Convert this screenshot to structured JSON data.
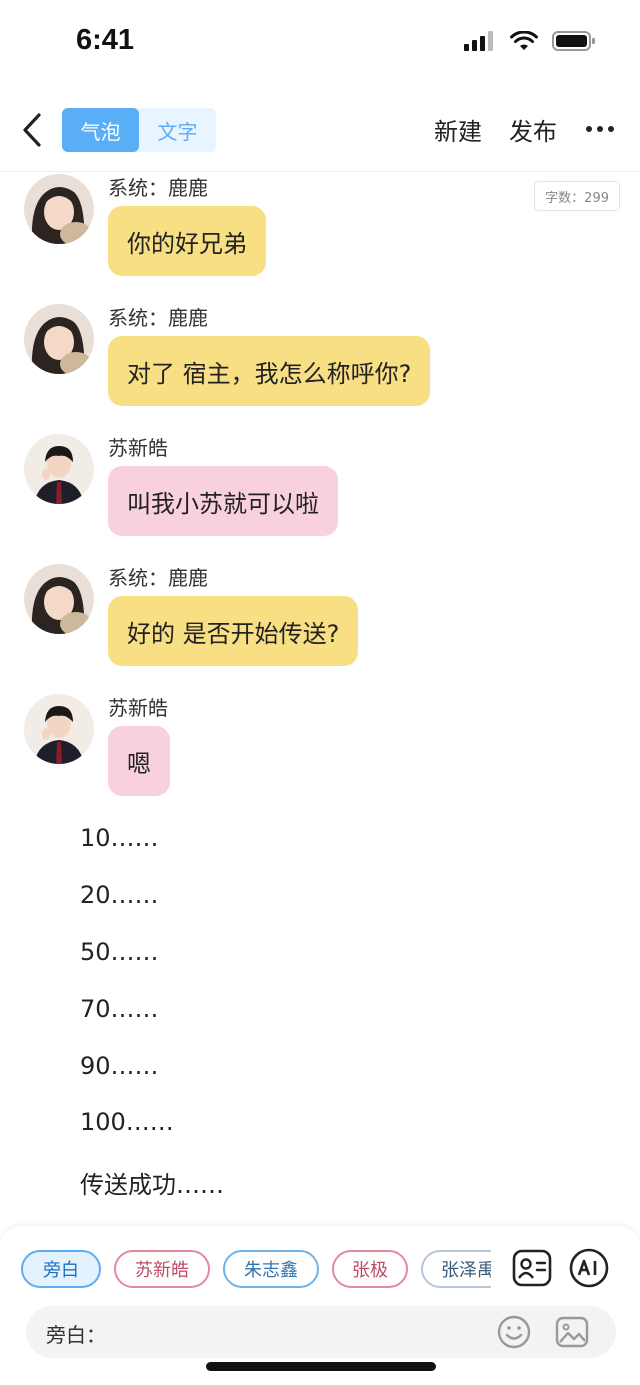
{
  "status_bar": {
    "time": "6:41"
  },
  "nav": {
    "mode_options": [
      "气泡",
      "文字"
    ],
    "active_mode": "气泡",
    "new_label": "新建",
    "publish_label": "发布"
  },
  "word_count": "字数：299",
  "messages": [
    {
      "sender": "系统：鹿鹿",
      "text": "你的好兄弟",
      "bubble_color": "#f8df84"
    },
    {
      "sender": "系统：鹿鹿",
      "text": "对了 宿主，我怎么称呼你?",
      "bubble_color": "#f8df84"
    },
    {
      "sender": "苏新皓",
      "text": "叫我小苏就可以啦",
      "bubble_color": "#f8d1dc"
    },
    {
      "sender": "系统：鹿鹿",
      "text": "好的 是否开始传送?",
      "bubble_color": "#f8df84"
    },
    {
      "sender": "苏新皓",
      "text": "嗯",
      "bubble_color": "#f8d1dc"
    }
  ],
  "narration": [
    "10……",
    "20……",
    "50……",
    "70……",
    "90……",
    "100……",
    "传送成功……"
  ],
  "roles": [
    "旁白",
    "苏新皓",
    "朱志鑫",
    "张极",
    "张泽禹"
  ],
  "input": {
    "label": "旁白："
  },
  "colors": {
    "accent": "#5aaef6",
    "system_bubble": "#f8df84",
    "user_bubble": "#f8d1dc"
  }
}
